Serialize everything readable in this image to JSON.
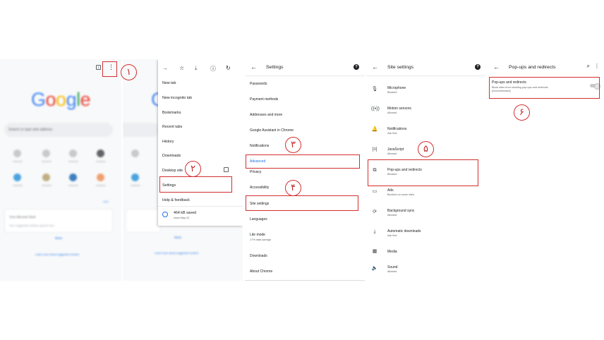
{
  "panel1": {
    "logo": [
      "G",
      "o",
      "o",
      "g",
      "l",
      "e"
    ],
    "logo_colors": [
      "#4285f4",
      "#ea4335",
      "#fbbc05",
      "#4285f4",
      "#34a853",
      "#ea4335"
    ],
    "search_placeholder": "Search or type web address",
    "tab_count": "1",
    "menu_dots": "⋮",
    "card_title": "Your discover feed",
    "card_sub": "Your suggested articles appear here",
    "more": "More",
    "footer": "Learn more about suggested content"
  },
  "panel2": {
    "menu_items": [
      "New tab",
      "New incognito tab",
      "Bookmarks",
      "Recent tabs",
      "History",
      "Downloads",
      "Desktop site",
      "Settings",
      "Help & feedback"
    ],
    "saved_title": "464 kB saved",
    "saved_sub": "since May 22",
    "more": "More",
    "footer": "Learn more about suggested content"
  },
  "panel3": {
    "title": "Settings",
    "items": [
      "Passwords",
      "Payment methods",
      "Addresses and more",
      "Google Assistant in Chrome",
      "Notifications",
      "Advanced",
      "Privacy",
      "Accessibility",
      "Site settings",
      "Languages",
      "Lite mode",
      "Downloads",
      "About Chrome"
    ],
    "lite_sub": "17% data savings"
  },
  "panel4": {
    "title": "Site settings",
    "items": [
      {
        "label": "Microphone",
        "sub": "Blocked",
        "icon": "mic-icon"
      },
      {
        "label": "Motion sensors",
        "sub": "Allowed",
        "icon": "motion-sensor-icon"
      },
      {
        "label": "Notifications",
        "sub": "Ask first",
        "icon": "bell-icon"
      },
      {
        "label": "JavaScript",
        "sub": "Allowed",
        "icon": "code-icon"
      },
      {
        "label": "Pop-ups and redirects",
        "sub": "Blocked",
        "icon": "open-external-icon"
      },
      {
        "label": "Ads",
        "sub": "Blocked on some sites",
        "icon": "ads-icon"
      },
      {
        "label": "Background sync",
        "sub": "Allowed",
        "icon": "sync-icon"
      },
      {
        "label": "Automatic downloads",
        "sub": "Ask first",
        "icon": "download-icon"
      },
      {
        "label": "Media",
        "sub": "",
        "icon": "media-icon"
      },
      {
        "label": "Sound",
        "sub": "Allowed",
        "icon": "speaker-icon"
      }
    ]
  },
  "panel5": {
    "title": "Pop-ups and redirects",
    "item_label": "Pop-ups and redirects",
    "item_desc": "Block sites from showing pop-ups and redirects",
    "item_rec": "(recommended)",
    "toggle_on": false
  },
  "steps": [
    "١",
    "٢",
    "٣",
    "۴",
    "۵",
    "۶"
  ],
  "accent": "#d32f2f"
}
